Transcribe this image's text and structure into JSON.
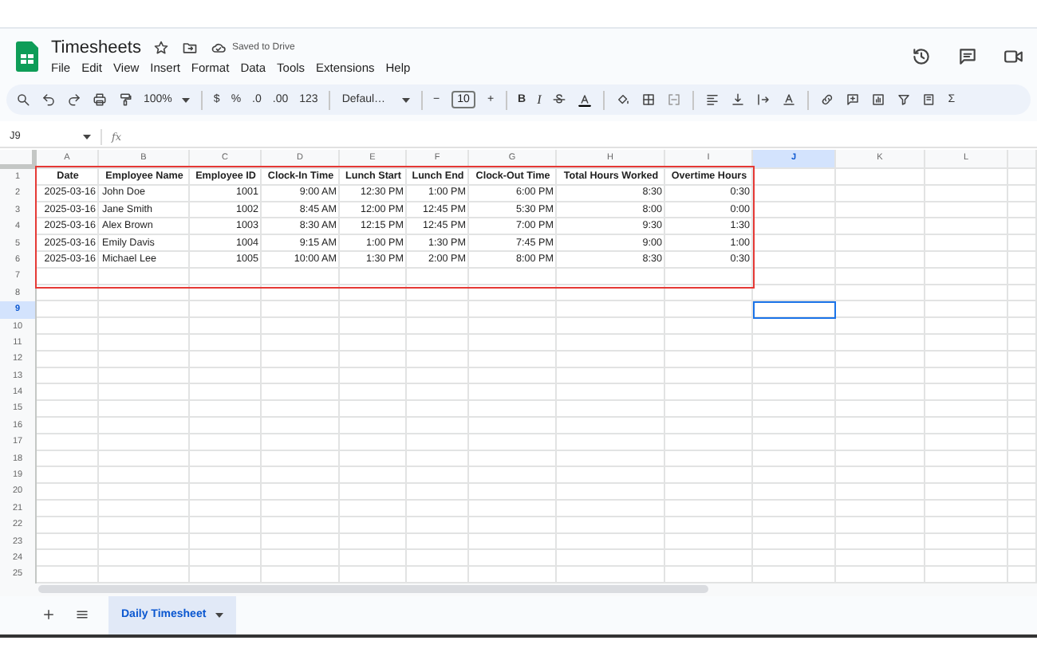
{
  "app": {
    "title": "Timesheets",
    "save_status": "Saved to Drive"
  },
  "menu": [
    "File",
    "Edit",
    "View",
    "Insert",
    "Format",
    "Data",
    "Tools",
    "Extensions",
    "Help"
  ],
  "toolbar": {
    "zoom": "100%",
    "currency": "$",
    "percent": "%",
    "decrease_decimals": ".0",
    "increase_decimals": ".00",
    "number_format": "123",
    "font": "Defaul…",
    "font_minus": "−",
    "font_size": "10",
    "font_plus": "+",
    "bold": "B",
    "italic": "I",
    "function": "Σ"
  },
  "name_box": "J9",
  "formula_label": "fx",
  "columns": [
    {
      "label": "A",
      "selected": false
    },
    {
      "label": "B",
      "selected": false
    },
    {
      "label": "C",
      "selected": false
    },
    {
      "label": "D",
      "selected": false
    },
    {
      "label": "E",
      "selected": false
    },
    {
      "label": "F",
      "selected": false
    },
    {
      "label": "G",
      "selected": false
    },
    {
      "label": "H",
      "selected": false
    },
    {
      "label": "I",
      "selected": false
    },
    {
      "label": "J",
      "selected": true
    },
    {
      "label": "K",
      "selected": false
    },
    {
      "label": "L",
      "selected": false
    }
  ],
  "rows": [
    {
      "number": "1",
      "selected": false,
      "kind": "header",
      "cells": [
        "Date",
        "Employee Name",
        "Employee ID",
        "Clock-In Time",
        "Lunch Start",
        "Lunch End",
        "Clock-Out Time",
        "Total Hours Worked",
        "Overtime Hours"
      ]
    },
    {
      "number": "2",
      "selected": false,
      "kind": "data",
      "cells": [
        "2025-03-16",
        "John Doe",
        "1001",
        "9:00 AM",
        "12:30 PM",
        "1:00 PM",
        "6:00 PM",
        "8:30",
        "0:30"
      ]
    },
    {
      "number": "3",
      "selected": false,
      "kind": "data",
      "cells": [
        "2025-03-16",
        "Jane Smith",
        "1002",
        "8:45 AM",
        "12:00 PM",
        "12:45 PM",
        "5:30 PM",
        "8:00",
        "0:00"
      ]
    },
    {
      "number": "4",
      "selected": false,
      "kind": "data",
      "cells": [
        "2025-03-16",
        "Alex Brown",
        "1003",
        "8:30 AM",
        "12:15 PM",
        "12:45 PM",
        "7:00 PM",
        "9:30",
        "1:30"
      ]
    },
    {
      "number": "5",
      "selected": false,
      "kind": "data",
      "cells": [
        "2025-03-16",
        "Emily Davis",
        "1004",
        "9:15 AM",
        "1:00 PM",
        "1:30 PM",
        "7:45 PM",
        "9:00",
        "1:00"
      ]
    },
    {
      "number": "6",
      "selected": false,
      "kind": "data",
      "cells": [
        "2025-03-16",
        "Michael Lee",
        "1005",
        "10:00 AM",
        "1:30 PM",
        "2:00 PM",
        "8:00 PM",
        "8:30",
        "0:30"
      ]
    },
    {
      "number": "7",
      "selected": false,
      "kind": "empty"
    },
    {
      "number": "8",
      "selected": false,
      "kind": "empty"
    },
    {
      "number": "9",
      "selected": true,
      "kind": "empty"
    },
    {
      "number": "10",
      "selected": false,
      "kind": "empty"
    },
    {
      "number": "11",
      "selected": false,
      "kind": "empty"
    },
    {
      "number": "12",
      "selected": false,
      "kind": "empty"
    },
    {
      "number": "13",
      "selected": false,
      "kind": "empty"
    },
    {
      "number": "14",
      "selected": false,
      "kind": "empty"
    },
    {
      "number": "15",
      "selected": false,
      "kind": "empty"
    },
    {
      "number": "16",
      "selected": false,
      "kind": "empty"
    },
    {
      "number": "17",
      "selected": false,
      "kind": "empty"
    },
    {
      "number": "18",
      "selected": false,
      "kind": "empty"
    },
    {
      "number": "19",
      "selected": false,
      "kind": "empty"
    },
    {
      "number": "20",
      "selected": false,
      "kind": "empty"
    },
    {
      "number": "21",
      "selected": false,
      "kind": "empty"
    },
    {
      "number": "22",
      "selected": false,
      "kind": "empty"
    },
    {
      "number": "23",
      "selected": false,
      "kind": "empty"
    },
    {
      "number": "24",
      "selected": false,
      "kind": "empty"
    },
    {
      "number": "25",
      "selected": false,
      "kind": "empty"
    }
  ],
  "sheet_tabs": [
    {
      "label": "Daily Timesheet",
      "selected": true
    }
  ]
}
